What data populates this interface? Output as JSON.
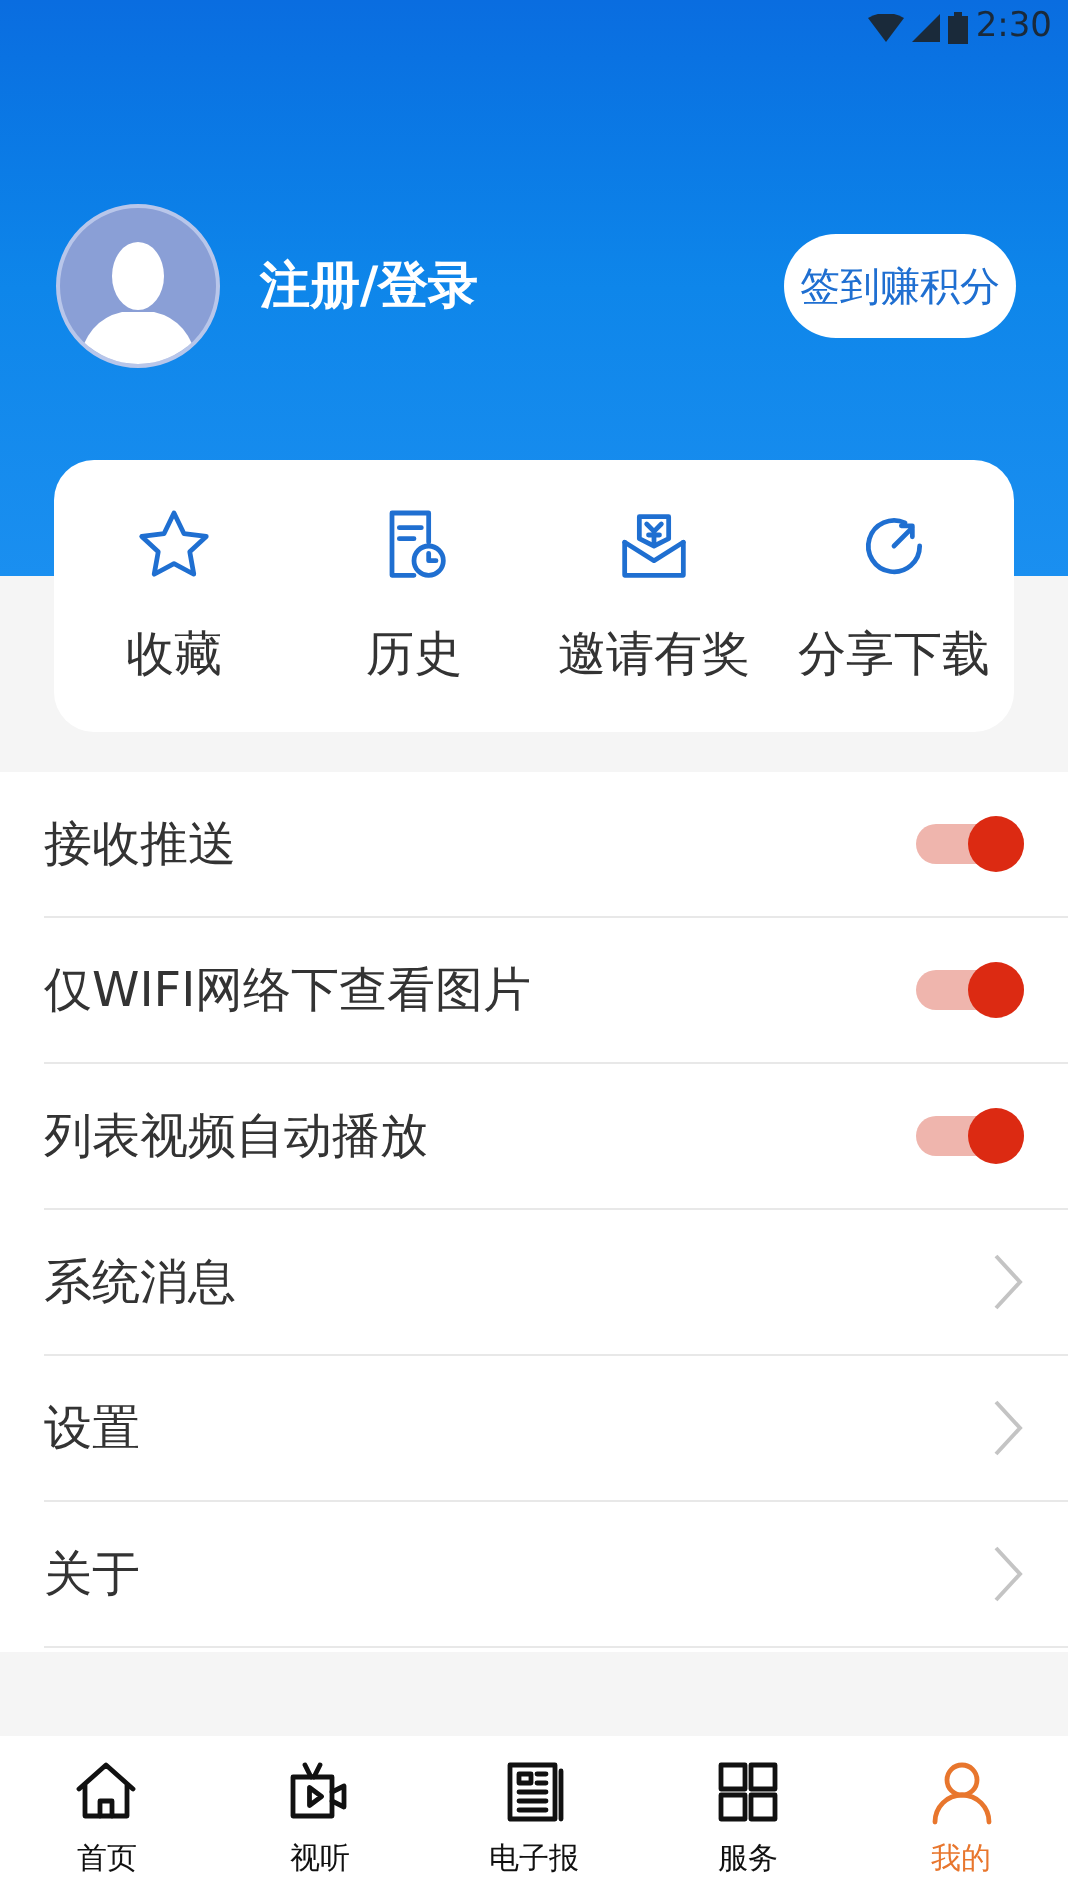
{
  "status_bar": {
    "time": "2:30"
  },
  "profile": {
    "login": "注册/登录",
    "checkin_button": "签到赚积分"
  },
  "shortcuts": [
    {
      "kind": "star",
      "label": "收藏"
    },
    {
      "kind": "history",
      "label": "历史"
    },
    {
      "kind": "invite",
      "label": "邀请有奖"
    },
    {
      "kind": "share",
      "label": "分享下载"
    }
  ],
  "settings": [
    {
      "kind": "toggle",
      "label": "接收推送",
      "on": true
    },
    {
      "kind": "toggle",
      "label": "仅WIFI网络下查看图片",
      "on": true
    },
    {
      "kind": "toggle",
      "label": "列表视频自动播放",
      "on": true
    },
    {
      "kind": "link",
      "label": "系统消息"
    },
    {
      "kind": "link",
      "label": "设置"
    },
    {
      "kind": "link",
      "label": "关于"
    }
  ],
  "bottom_nav": [
    {
      "kind": "home",
      "label": "首页",
      "selected": false
    },
    {
      "kind": "video",
      "label": "视听",
      "selected": false
    },
    {
      "kind": "paper",
      "label": "电子报",
      "selected": false
    },
    {
      "kind": "grid",
      "label": "服务",
      "selected": false
    },
    {
      "kind": "user",
      "label": "我的",
      "selected": true
    }
  ]
}
